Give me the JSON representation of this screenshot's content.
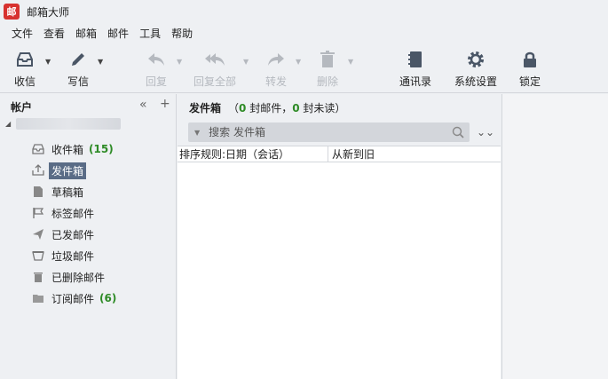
{
  "app": {
    "logo_char": "邮",
    "title": "邮箱大师"
  },
  "menu": [
    "文件",
    "查看",
    "邮箱",
    "邮件",
    "工具",
    "帮助"
  ],
  "toolbar": {
    "receive": "收信",
    "compose": "写信",
    "reply": "回复",
    "reply_all": "回复全部",
    "forward": "转发",
    "delete": "删除",
    "contacts": "通讯录",
    "settings": "系统设置",
    "lock": "锁定"
  },
  "sidebar": {
    "header": "帐户",
    "folders": [
      {
        "label": "收件箱",
        "count": "(15)",
        "icon": "inbox-icon"
      },
      {
        "label": "发件箱",
        "count": "",
        "icon": "outbox-icon",
        "selected": true
      },
      {
        "label": "草稿箱",
        "count": "",
        "icon": "drafts-icon"
      },
      {
        "label": "标签邮件",
        "count": "",
        "icon": "flag-icon"
      },
      {
        "label": "已发邮件",
        "count": "",
        "icon": "sent-icon"
      },
      {
        "label": "垃圾邮件",
        "count": "",
        "icon": "spam-icon"
      },
      {
        "label": "已删除邮件",
        "count": "",
        "icon": "trash-icon"
      },
      {
        "label": "订阅邮件",
        "count": "(6)",
        "icon": "folder-icon"
      }
    ]
  },
  "main": {
    "folder_name": "发件箱",
    "summary_open": "（",
    "total": "0",
    "total_unit": " 封邮件，",
    "unread": "0",
    "unread_unit": " 封未读）",
    "search_placeholder": "搜索 发件箱",
    "sort_rule": "排序规则:日期（会话）",
    "sort_order": "从新到旧"
  },
  "colors": {
    "accent_green": "#2e8b26",
    "selection": "#5a6c86",
    "logo_red": "#d7322f"
  }
}
